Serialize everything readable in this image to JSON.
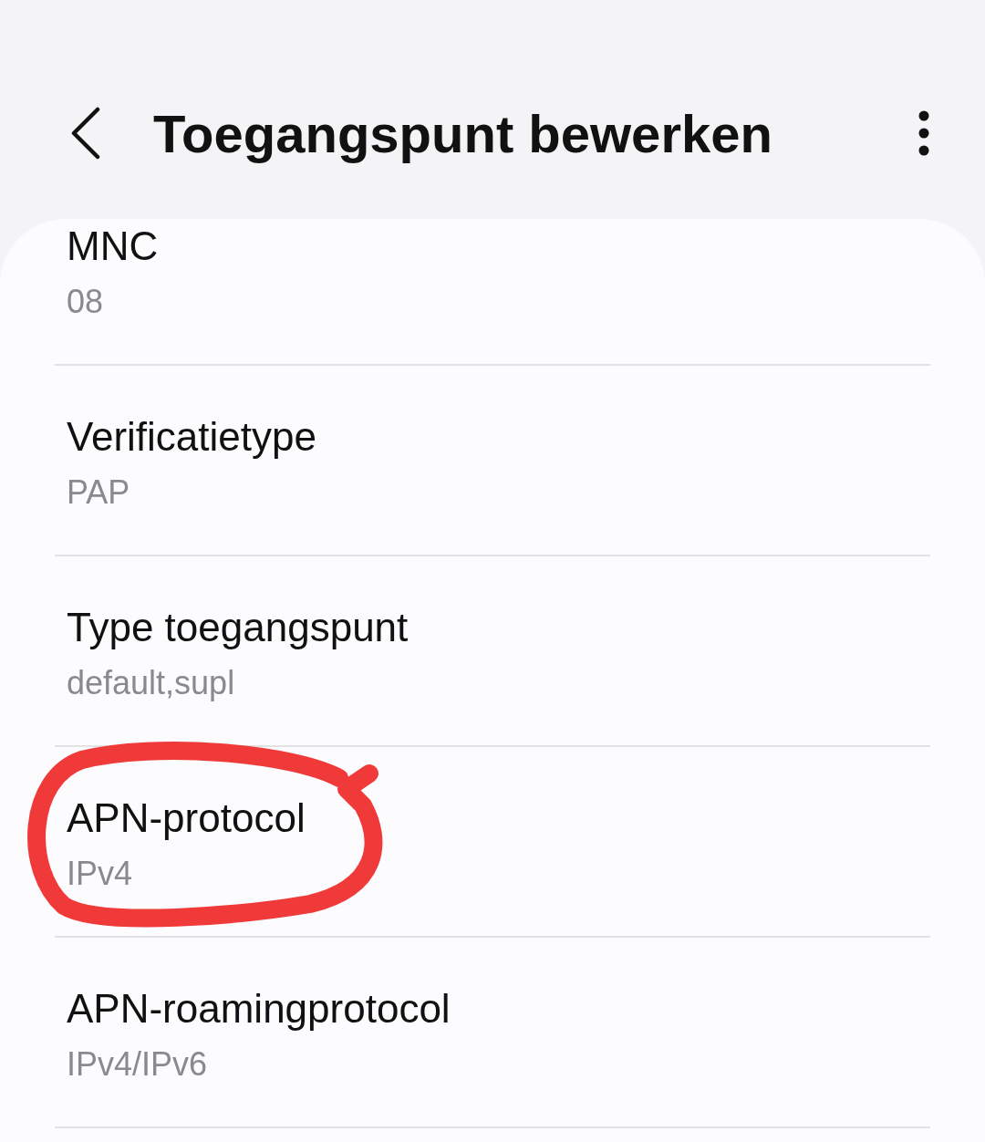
{
  "header": {
    "title": "Toegangspunt bewerken"
  },
  "rows": [
    {
      "label": "MNC",
      "value": "08",
      "circled": false
    },
    {
      "label": "Verificatietype",
      "value": "PAP",
      "circled": false
    },
    {
      "label": "Type toegangspunt",
      "value": "default,supl",
      "circled": false
    },
    {
      "label": "APN-protocol",
      "value": "IPv4",
      "circled": true
    },
    {
      "label": "APN-roamingprotocol",
      "value": "IPv4/IPv6",
      "circled": false
    }
  ]
}
